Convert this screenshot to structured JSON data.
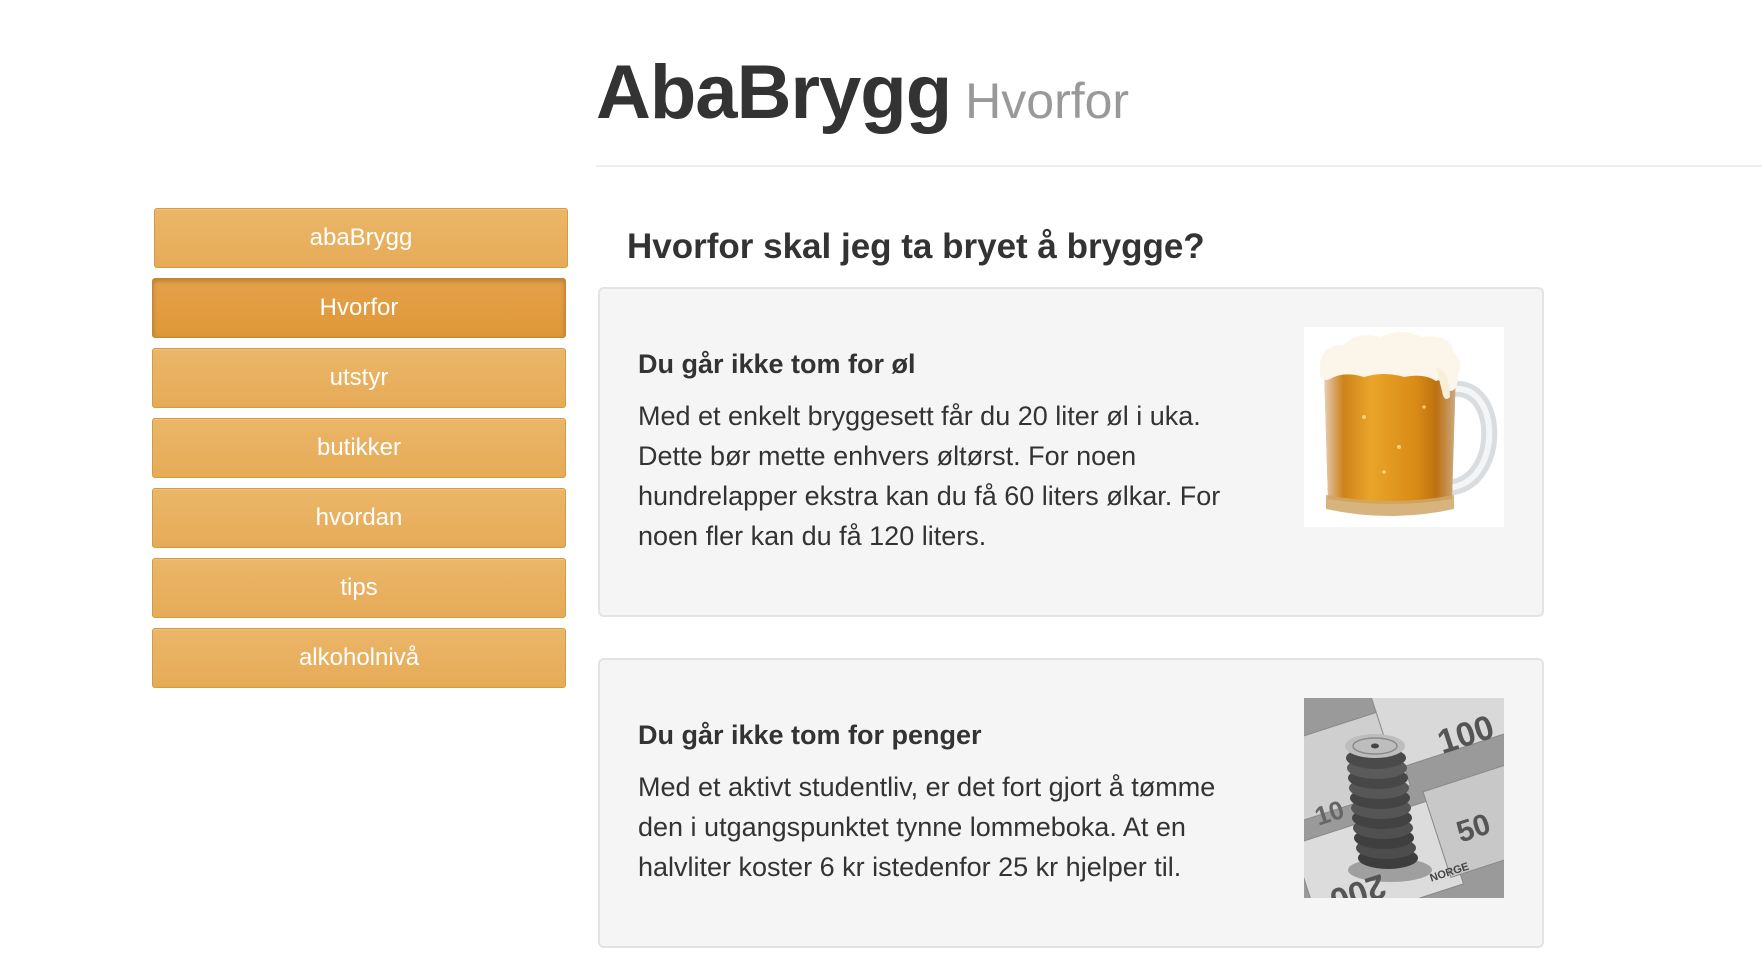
{
  "header": {
    "title": "AbaBrygg",
    "subtitle": "Hvorfor"
  },
  "sidebar": {
    "items": [
      {
        "label": "abaBrygg",
        "active": false
      },
      {
        "label": "Hvorfor",
        "active": true
      },
      {
        "label": "utstyr",
        "active": false
      },
      {
        "label": "butikker",
        "active": false
      },
      {
        "label": "hvordan",
        "active": false
      },
      {
        "label": "tips",
        "active": false
      },
      {
        "label": "alkoholnivå",
        "active": false
      }
    ]
  },
  "main": {
    "heading": "Hvorfor skal jeg ta bryet å brygge?",
    "cards": [
      {
        "title": "Du går ikke tom for øl",
        "text": "Med et enkelt bryggesett får du 20 liter øl i uka. Dette bør mette enhvers øltørst. For noen hundrelapper ekstra kan du få 60 liters ølkar. For noen fler kan du få 120 liters.",
        "image_icon": "beer-mug-image"
      },
      {
        "title": "Du går ikke tom for penger",
        "text": "Med et aktivt studentliv, er det fort gjort å tømme den i utgangspunktet tynne lommeboka. At en halvliter koster 6 kr istedenfor 25 kr hjelper til.",
        "image_icon": "coins-and-banknotes-image",
        "image_text": {
          "note_values": [
            "100",
            "200",
            "50",
            "10"
          ],
          "country": "NORGE"
        }
      }
    ]
  },
  "colors": {
    "nav_button": "#e8b05e",
    "nav_button_active": "#e09a3c",
    "card_background": "#f5f5f5",
    "subtitle": "#999999",
    "text": "#333333"
  }
}
